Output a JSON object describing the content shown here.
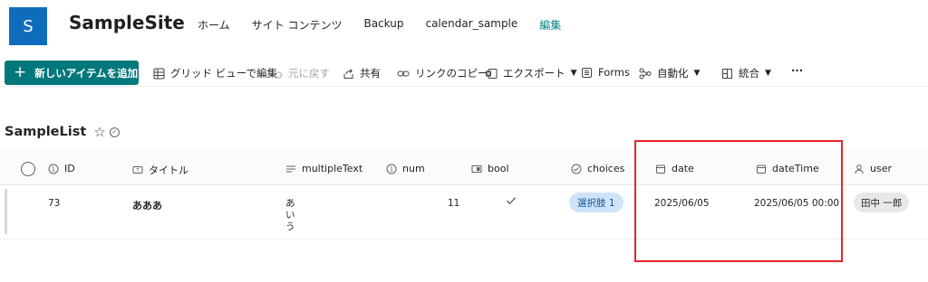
{
  "site": {
    "logo_letter": "S",
    "title": "SampleSite",
    "nav": [
      {
        "label": "ホーム"
      },
      {
        "label": "サイト コンテンツ"
      },
      {
        "label": "Backup"
      },
      {
        "label": "calendar_sample"
      },
      {
        "label": "編集"
      }
    ],
    "accent_color": "#03787c"
  },
  "commandbar": {
    "new_item": "新しいアイテムを追加",
    "grid_view": "グリッド ビューで編集",
    "undo": "元に戻す",
    "share": "共有",
    "copy_link": "リンクのコピー",
    "export": "エクスポート",
    "forms": "Forms",
    "automate": "自動化",
    "integrate": "統合",
    "more": "···"
  },
  "list": {
    "title": "SampleList",
    "columns": [
      {
        "label": "ID",
        "icon": "number-icon"
      },
      {
        "label": "タイトル",
        "icon": "text-icon"
      },
      {
        "label": "multipleText",
        "icon": "lines-icon"
      },
      {
        "label": "num",
        "icon": "number-icon"
      },
      {
        "label": "bool",
        "icon": "bool-icon"
      },
      {
        "label": "choices",
        "icon": "choice-icon"
      },
      {
        "label": "date",
        "icon": "calendar-icon"
      },
      {
        "label": "dateTime",
        "icon": "calendar-icon"
      },
      {
        "label": "user",
        "icon": "person-icon"
      }
    ],
    "rows": [
      {
        "id": "73",
        "title": "あああ",
        "multipleText": "あ\nい\nう",
        "num": "11",
        "bool": true,
        "choices": "選択肢 1",
        "date": "2025/06/05",
        "dateTime": "2025/06/05 00:00",
        "user": "田中 一郎"
      }
    ]
  }
}
